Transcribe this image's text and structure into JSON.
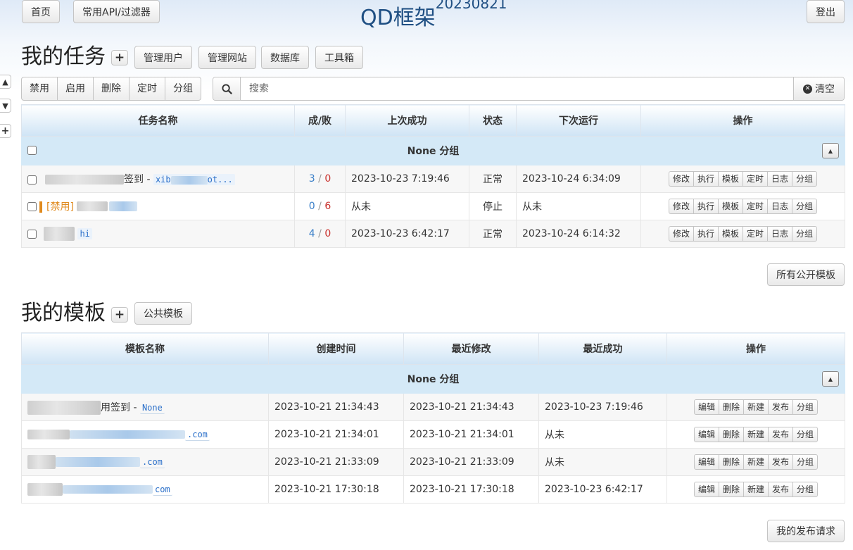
{
  "nav": {
    "home_label": "首页",
    "api_label": "常用API/过滤器",
    "logout_label": "登出"
  },
  "site": {
    "title": "QD框架",
    "version": "20230821"
  },
  "tasks": {
    "title": "我的任务",
    "manage_users_label": "管理用户",
    "manage_sites_label": "管理网站",
    "database_label": "数据库",
    "toolbox_label": "工具箱",
    "toolbar": [
      "禁用",
      "启用",
      "删除",
      "定时",
      "分组"
    ],
    "search_placeholder": "搜索",
    "clear_label": "清空",
    "columns": [
      "任务名称",
      "成/败",
      "上次成功",
      "状态",
      "下次运行",
      "操作"
    ],
    "group_label": "None 分组",
    "ops": [
      "修改",
      "执行",
      "模板",
      "定时",
      "日志",
      "分组"
    ],
    "rows": [
      {
        "name_text": "签到 - ",
        "code": "xib",
        "code_tail": "ot...",
        "success": "3",
        "fail": "0",
        "last_success": "2023-10-23 7:19:46",
        "status": "正常",
        "next_run": "2023-10-24 6:34:09"
      },
      {
        "disabled_tag": "[禁用]",
        "success": "0",
        "fail": "6",
        "last_success": "从未",
        "status": "停止",
        "next_run": "从未"
      },
      {
        "code": "hi",
        "success": "4",
        "fail": "0",
        "last_success": "2023-10-23 6:42:17",
        "status": "正常",
        "next_run": "2023-10-24 6:14:32"
      }
    ],
    "all_public_templates_label": "所有公开模板"
  },
  "templates": {
    "title": "我的模板",
    "public_label": "公共模板",
    "columns": [
      "模板名称",
      "创建时间",
      "最近修改",
      "最近成功",
      "操作"
    ],
    "group_label": "None 分组",
    "ops": [
      "编辑",
      "删除",
      "新建",
      "发布",
      "分组"
    ],
    "rows": [
      {
        "name_text": "用签到 - ",
        "code": "None",
        "created": "2023-10-21 21:34:43",
        "modified": "2023-10-21 21:34:43",
        "last_success": "2023-10-23 7:19:46"
      },
      {
        "code": ".com",
        "created": "2023-10-21 21:34:01",
        "modified": "2023-10-21 21:34:01",
        "last_success": "从未"
      },
      {
        "code": ".com",
        "created": "2023-10-21 21:33:09",
        "modified": "2023-10-21 21:33:09",
        "last_success": "从未"
      },
      {
        "code": "com",
        "created": "2023-10-21 17:30:18",
        "modified": "2023-10-21 17:30:18",
        "last_success": "2023-10-23 6:42:17"
      }
    ],
    "my_publish_requests_label": "我的发布请求"
  },
  "colors": {
    "accent": "#1f4f83",
    "header_blue": "#cfe4f5",
    "group_blue": "#d4e9f7",
    "success": "#3a7fc8",
    "fail": "#c9302c",
    "disabled": "#e08a1e"
  }
}
